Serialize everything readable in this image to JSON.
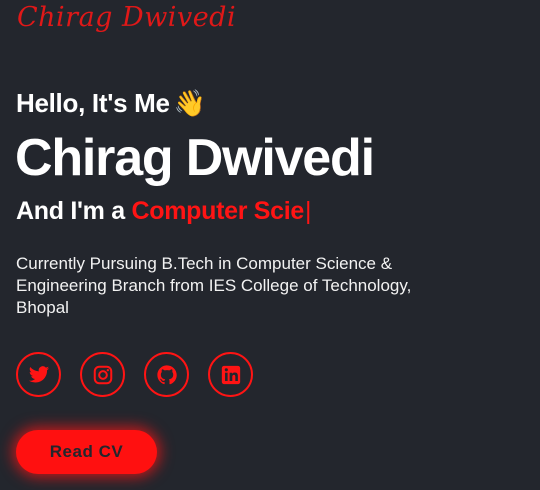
{
  "brand": {
    "logo_text": "Chirag Dwivedi"
  },
  "hero": {
    "greeting": "Hello, It's Me",
    "greeting_emoji": "👋",
    "name": "Chirag Dwivedi",
    "role_prefix": "And I'm a",
    "role_typed": "Computer Scie",
    "cursor": "|",
    "description": "Currently Pursuing B.Tech in Computer Science & Engineering Branch from IES College of Technology, Bhopal"
  },
  "socials": [
    {
      "name": "twitter",
      "icon": "twitter-icon"
    },
    {
      "name": "instagram",
      "icon": "instagram-icon"
    },
    {
      "name": "github",
      "icon": "github-icon"
    },
    {
      "name": "linkedin",
      "icon": "linkedin-icon"
    }
  ],
  "cta": {
    "label": "Read CV"
  },
  "colors": {
    "background": "#23262d",
    "accent": "#ff1414",
    "text": "#ffffff"
  }
}
